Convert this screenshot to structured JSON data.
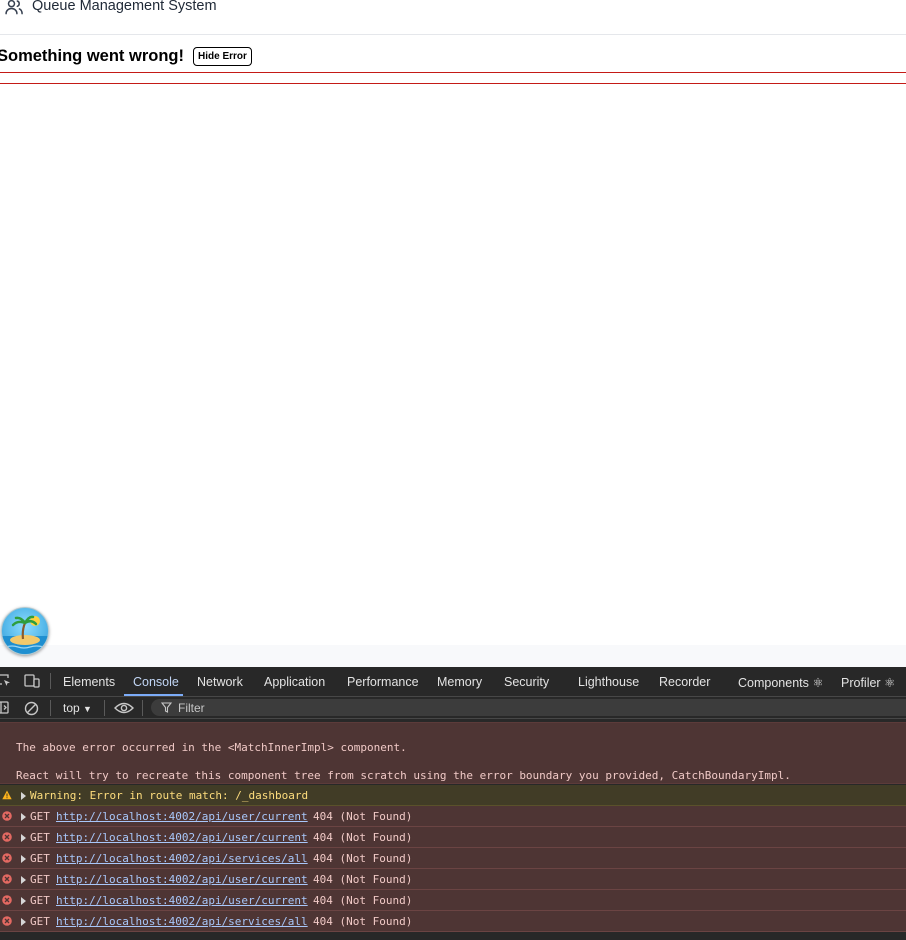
{
  "app": {
    "title": "Queue Management System",
    "error_title": "Something went wrong!",
    "hide_error_label": "Hide Error"
  },
  "devtools": {
    "tabs": [
      {
        "label": "Elements",
        "active": false
      },
      {
        "label": "Console",
        "active": true
      },
      {
        "label": "Network",
        "active": false
      },
      {
        "label": "Application",
        "active": false
      },
      {
        "label": "Performance",
        "active": false
      },
      {
        "label": "Memory",
        "active": false
      },
      {
        "label": "Security",
        "active": false
      },
      {
        "label": "Lighthouse",
        "active": false
      },
      {
        "label": "Recorder",
        "active": false
      },
      {
        "label": "Components ⚛",
        "active": false
      },
      {
        "label": "Profiler ⚛",
        "active": false
      }
    ],
    "context": "top",
    "filter_placeholder": "Filter",
    "error_block": {
      "line1": "The above error occurred in the <MatchInnerImpl> component.",
      "line2": "React will try to recreate this component tree from scratch using the error boundary you provided, CatchBoundaryImpl."
    },
    "warning": "Warning: Error in route match: /_dashboard",
    "requests": [
      {
        "method": "GET",
        "url": "http://localhost:4002/api/user/current",
        "status": "404 (Not Found)"
      },
      {
        "method": "GET",
        "url": "http://localhost:4002/api/user/current",
        "status": "404 (Not Found)"
      },
      {
        "method": "GET",
        "url": "http://localhost:4002/api/services/all",
        "status": "404 (Not Found)"
      },
      {
        "method": "GET",
        "url": "http://localhost:4002/api/user/current",
        "status": "404 (Not Found)"
      },
      {
        "method": "GET",
        "url": "http://localhost:4002/api/user/current",
        "status": "404 (Not Found)"
      },
      {
        "method": "GET",
        "url": "http://localhost:4002/api/services/all",
        "status": "404 (Not Found)"
      }
    ],
    "colors": {
      "error_bg": "#4e3534",
      "warning_bg": "#413c26",
      "link": "#a8c7fa",
      "active_tab": "#7cacf8"
    }
  }
}
